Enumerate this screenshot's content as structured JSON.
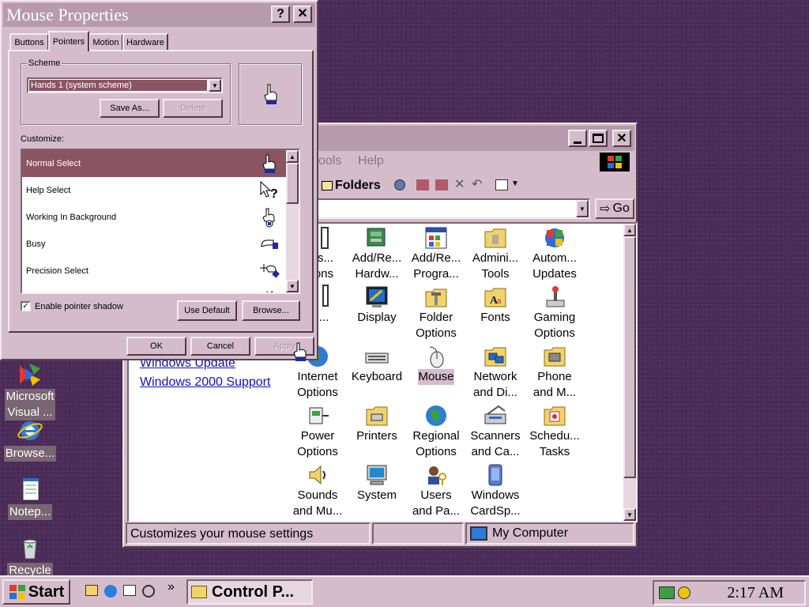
{
  "desktop": {
    "icons": [
      {
        "label": "Microsoft\nVisual ...",
        "icon": "visual-studio-icon"
      },
      {
        "label": "Browse...",
        "icon": "internet-explorer-icon"
      },
      {
        "label": "Notep...",
        "icon": "notepad-icon"
      },
      {
        "label": "Recycle",
        "icon": "recycle-bin-icon"
      }
    ]
  },
  "control_panel": {
    "menu": {
      "tools": "ools",
      "help": "Help"
    },
    "toolbar": {
      "folders": "Folders",
      "go": "Go"
    },
    "links": {
      "windows_update": "Windows Update",
      "win2000_support": "Windows 2000 Support"
    },
    "icons": [
      {
        "label": "...ss...\nptions"
      },
      {
        "label": "Add/Re...\nHardw...",
        "icon": "add-hardware-icon"
      },
      {
        "label": "Add/Re...\nProgra...",
        "icon": "add-remove-programs-icon"
      },
      {
        "label": "Admini...\nTools",
        "icon": "admin-tools-icon"
      },
      {
        "label": "Autom...\nUpdates",
        "icon": "automatic-updates-icon"
      },
      {
        "label": "/Ti..."
      },
      {
        "label": "Display",
        "icon": "display-icon"
      },
      {
        "label": "Folder\nOptions",
        "icon": "folder-options-icon"
      },
      {
        "label": "Fonts",
        "icon": "fonts-icon"
      },
      {
        "label": "Gaming\nOptions",
        "icon": "gaming-options-icon"
      },
      {
        "label": "Internet\nOptions",
        "icon": "internet-options-icon"
      },
      {
        "label": "Keyboard",
        "icon": "keyboard-icon"
      },
      {
        "label": "Mouse",
        "icon": "mouse-icon"
      },
      {
        "label": "Network\nand Di...",
        "icon": "network-icon"
      },
      {
        "label": "Phone\nand M...",
        "icon": "phone-modem-icon"
      },
      {
        "label": "Power\nOptions",
        "icon": "power-options-icon"
      },
      {
        "label": "Printers",
        "icon": "printers-icon"
      },
      {
        "label": "Regional\nOptions",
        "icon": "regional-options-icon"
      },
      {
        "label": "Scanners\nand Ca...",
        "icon": "scanners-cameras-icon"
      },
      {
        "label": "Schedu...\nTasks",
        "icon": "scheduled-tasks-icon"
      },
      {
        "label": "Sounds\nand Mu...",
        "icon": "sounds-icon"
      },
      {
        "label": "System",
        "icon": "system-icon"
      },
      {
        "label": "Users\nand Pa...",
        "icon": "users-passwords-icon"
      },
      {
        "label": "Windows\nCardSp...",
        "icon": "cardspace-icon"
      }
    ],
    "status": {
      "text": "Customizes your mouse settings",
      "zone": "My Computer"
    }
  },
  "mouse_properties": {
    "title": "Mouse Properties",
    "tabs": [
      "Buttons",
      "Pointers",
      "Motion",
      "Hardware"
    ],
    "active_tab": "Pointers",
    "scheme": {
      "label": "Scheme",
      "value": "Hands 1 (system scheme)",
      "save_as": "Save As...",
      "delete": "Delete"
    },
    "customize_label": "Customize:",
    "cursors": [
      {
        "name": "Normal Select",
        "icon": "hand-pointer-icon"
      },
      {
        "name": "Help Select",
        "icon": "help-select-icon"
      },
      {
        "name": "Working In Background",
        "icon": "working-hand-icon"
      },
      {
        "name": "Busy",
        "icon": "busy-hand-icon"
      },
      {
        "name": "Precision Select",
        "icon": "precision-hand-icon"
      }
    ],
    "shadow": {
      "label": "Enable pointer shadow",
      "checked": true
    },
    "use_default": "Use Default",
    "browse": "Browse...",
    "ok": "OK",
    "cancel": "Cancel",
    "apply": "Apply"
  },
  "taskbar": {
    "start": "Start",
    "task": "Control P...",
    "clock": "2:17 AM",
    "chevron": "»"
  }
}
